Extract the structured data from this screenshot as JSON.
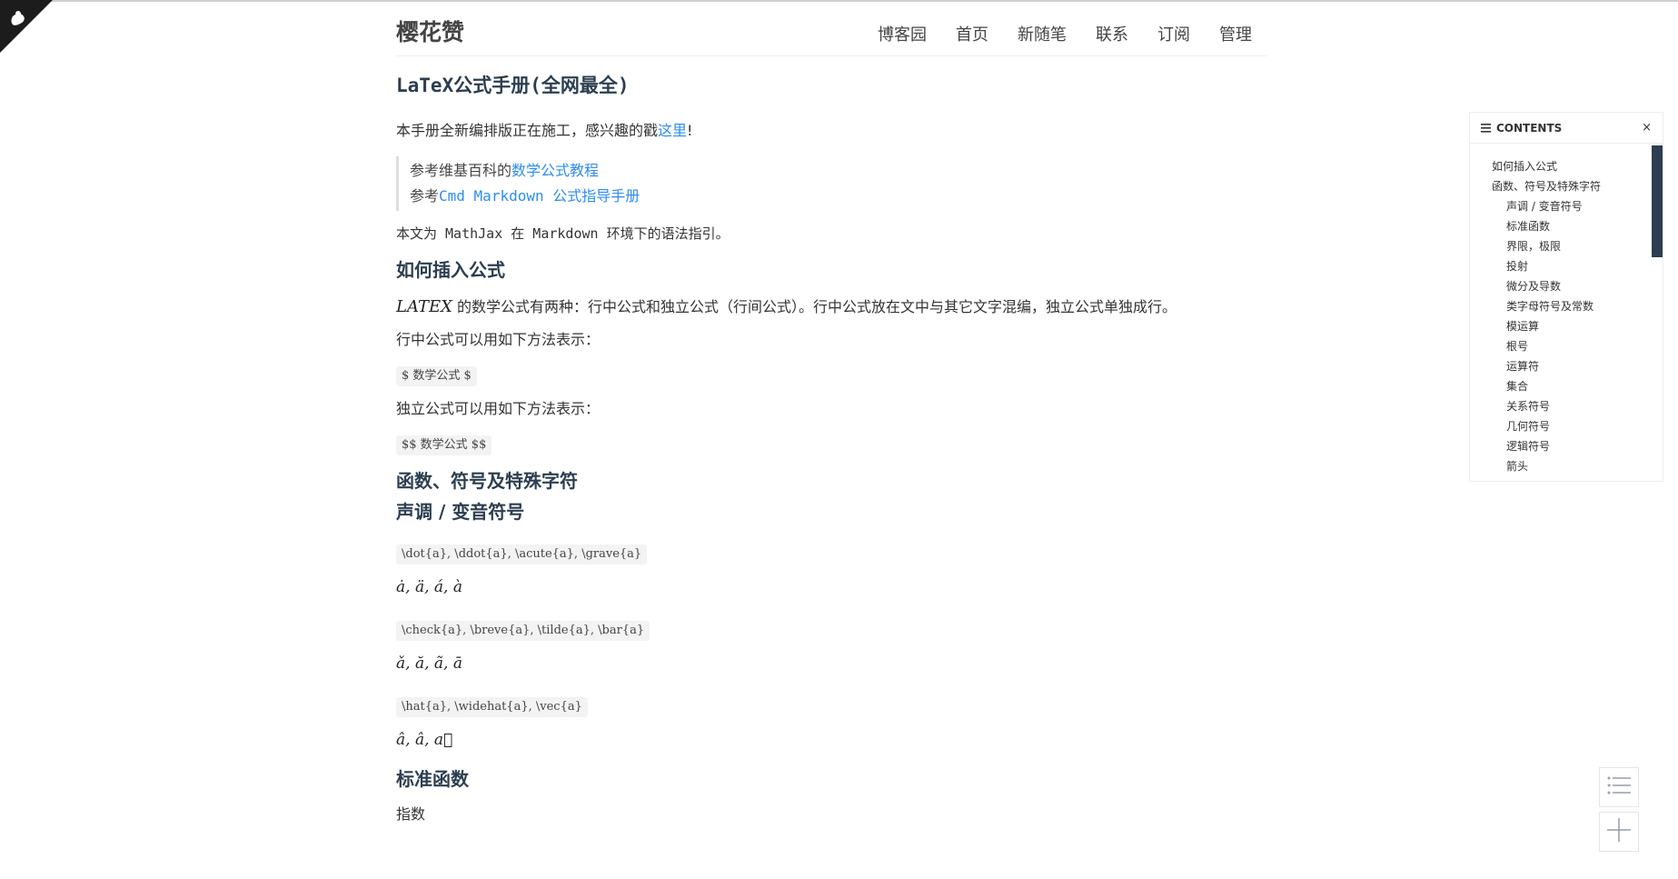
{
  "site": {
    "title": "樱花赞",
    "nav": [
      "博客园",
      "首页",
      "新随笔",
      "联系",
      "订阅",
      "管理"
    ]
  },
  "article": {
    "title": "LaTeX公式手册(全网最全)",
    "intro_text": "本手册全新编排版正在施工，感兴趣的戳",
    "intro_link": "这里",
    "intro_end": "!",
    "ref1_prefix": "参考维基百科的",
    "ref1_link": "数学公式教程",
    "ref2_prefix": "参考",
    "ref2_link": "Cmd Markdown 公式指导手册",
    "env_text": "本文为 MathJax 在 Markdown 环境下的语法指引。",
    "h_insert": "如何插入公式",
    "latex_logo": "LATEX",
    "latex_desc": "的数学公式有两种：行中公式和独立公式（行间公式）。行中公式放在文中与其它文字混编，独立公式单独成行。",
    "inline_desc": "行中公式可以用如下方法表示：",
    "inline_code": "$ 数学公式 $",
    "block_desc": "独立公式可以用如下方法表示：",
    "block_code": "$$ 数学公式 $$",
    "h_functions": "函数、符号及特殊字符",
    "h_accents": "声调 / 变音符号",
    "code1": "\\dot{a}, \\ddot{a}, \\acute{a}, \\grave{a}",
    "math1": "ȧ, ä, á, à",
    "code2": "\\check{a}, \\breve{a}, \\tilde{a}, \\bar{a}",
    "math2": "ǎ, ă, ã, ā",
    "code3": "\\hat{a}, \\widehat{a}, \\vec{a}",
    "math3": "â, â, a⃗",
    "h_standard": "标准函数",
    "exponent": "指数"
  },
  "toc": {
    "title": "CONTENTS",
    "close": "×",
    "items": [
      {
        "label": "如何插入公式",
        "level": 1
      },
      {
        "label": "函数、符号及特殊字符",
        "level": 1
      },
      {
        "label": "声调 / 变音符号",
        "level": 2
      },
      {
        "label": "标准函数",
        "level": 2
      },
      {
        "label": "界限，极限",
        "level": 2
      },
      {
        "label": "投射",
        "level": 2
      },
      {
        "label": "微分及导数",
        "level": 2
      },
      {
        "label": "类字母符号及常数",
        "level": 2
      },
      {
        "label": "模运算",
        "level": 2
      },
      {
        "label": "根号",
        "level": 2
      },
      {
        "label": "运算符",
        "level": 2
      },
      {
        "label": "集合",
        "level": 2
      },
      {
        "label": "关系符号",
        "level": 2
      },
      {
        "label": "几何符号",
        "level": 2
      },
      {
        "label": "逻辑符号",
        "level": 2
      },
      {
        "label": "箭头",
        "level": 2
      }
    ]
  },
  "colors": {
    "link": "#2d8cf0",
    "heading": "#2c3e50",
    "toc_scroll": "#2c3e50"
  },
  "icons": [
    "corner-badge-icon",
    "list-icon",
    "close-icon",
    "toc-icon",
    "plus-icon"
  ]
}
